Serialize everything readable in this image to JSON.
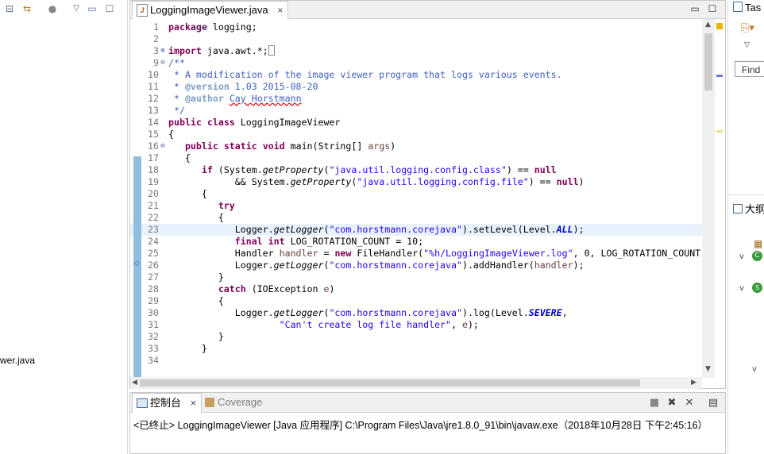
{
  "editor": {
    "tab_label": "LoggingImageViewer.java",
    "close_glyph": "×",
    "lines": [
      {
        "n": "1",
        "fold": "",
        "current": false,
        "tokens": [
          [
            "kw",
            "package"
          ],
          [
            "",
            " logging;"
          ]
        ]
      },
      {
        "n": "2",
        "fold": "",
        "current": false,
        "tokens": []
      },
      {
        "n": "3",
        "fold": "⊕",
        "current": false,
        "tokens": [
          [
            "kw",
            "import"
          ],
          [
            "",
            " java.awt.*;"
          ],
          [
            "box",
            " "
          ]
        ]
      },
      {
        "n": "9",
        "fold": "⊖",
        "current": false,
        "tokens": [
          [
            "cm",
            "/**"
          ]
        ]
      },
      {
        "n": "10",
        "fold": "",
        "current": false,
        "tokens": [
          [
            "cm",
            " * A modification of the image viewer program that logs various events."
          ]
        ]
      },
      {
        "n": "11",
        "fold": "",
        "current": false,
        "tokens": [
          [
            "cm",
            " * "
          ],
          [
            "ann",
            "@version"
          ],
          [
            "cm",
            " 1.03 2015-08-20"
          ]
        ]
      },
      {
        "n": "12",
        "fold": "",
        "current": false,
        "tokens": [
          [
            "cm",
            " * "
          ],
          [
            "ann",
            "@author"
          ],
          [
            "cm",
            " "
          ],
          [
            "cmsq",
            "Cay Horstmann"
          ]
        ]
      },
      {
        "n": "13",
        "fold": "",
        "current": false,
        "tokens": [
          [
            "cm",
            " */"
          ]
        ]
      },
      {
        "n": "14",
        "fold": "",
        "current": false,
        "tokens": [
          [
            "kw",
            "public"
          ],
          [
            "",
            " "
          ],
          [
            "kw",
            "class"
          ],
          [
            "",
            " LoggingImageViewer"
          ]
        ]
      },
      {
        "n": "15",
        "fold": "",
        "current": false,
        "tokens": [
          [
            "",
            "{"
          ]
        ]
      },
      {
        "n": "16",
        "fold": "⊖",
        "current": false,
        "tokens": [
          [
            "",
            "   "
          ],
          [
            "kw",
            "public"
          ],
          [
            "",
            " "
          ],
          [
            "kw",
            "static"
          ],
          [
            "",
            " "
          ],
          [
            "kw",
            "void"
          ],
          [
            "",
            " main(String[] "
          ],
          [
            "var",
            "args"
          ],
          [
            "",
            ")"
          ]
        ]
      },
      {
        "n": "17",
        "fold": "",
        "current": false,
        "tokens": [
          [
            "",
            "   {"
          ]
        ]
      },
      {
        "n": "18",
        "fold": "",
        "current": false,
        "tokens": [
          [
            "",
            "      "
          ],
          [
            "kw",
            "if"
          ],
          [
            "",
            " (System."
          ],
          [
            "it",
            "getProperty"
          ],
          [
            "",
            "("
          ],
          [
            "str",
            "\"java.util.logging.config.class\""
          ],
          [
            "",
            ") == "
          ],
          [
            "kw",
            "null"
          ]
        ]
      },
      {
        "n": "19",
        "fold": "",
        "current": false,
        "tokens": [
          [
            "",
            "            && System."
          ],
          [
            "it",
            "getProperty"
          ],
          [
            "",
            "("
          ],
          [
            "str",
            "\"java.util.logging.config.file\""
          ],
          [
            "",
            ") == "
          ],
          [
            "kw",
            "null"
          ],
          [
            "",
            ")"
          ]
        ]
      },
      {
        "n": "20",
        "fold": "",
        "current": false,
        "tokens": [
          [
            "",
            "      {"
          ]
        ]
      },
      {
        "n": "21",
        "fold": "",
        "current": false,
        "tokens": [
          [
            "",
            "         "
          ],
          [
            "kw",
            "try"
          ]
        ]
      },
      {
        "n": "22",
        "fold": "",
        "current": false,
        "tokens": [
          [
            "",
            "         {"
          ]
        ]
      },
      {
        "n": "23",
        "fold": "",
        "current": true,
        "tokens": [
          [
            "",
            "            Logger."
          ],
          [
            "it",
            "getLogger"
          ],
          [
            "",
            "("
          ],
          [
            "str",
            "\"com.horstmann.corejava\""
          ],
          [
            "",
            ").setLevel(Level."
          ],
          [
            "cst",
            "ALL"
          ],
          [
            "",
            ");"
          ]
        ]
      },
      {
        "n": "24",
        "fold": "",
        "current": false,
        "tokens": [
          [
            "",
            "            "
          ],
          [
            "kw",
            "final"
          ],
          [
            "",
            " "
          ],
          [
            "kw",
            "int"
          ],
          [
            "",
            " LOG_ROTATION_COUNT = 10;"
          ]
        ]
      },
      {
        "n": "25",
        "fold": "",
        "current": false,
        "tokens": [
          [
            "",
            "            Handler "
          ],
          [
            "var",
            "handler"
          ],
          [
            "",
            " = "
          ],
          [
            "kw",
            "new"
          ],
          [
            "",
            " FileHandler("
          ],
          [
            "str",
            "\"%h/LoggingImageViewer.log\""
          ],
          [
            "",
            ", 0, LOG_ROTATION_COUNT"
          ]
        ]
      },
      {
        "n": "26",
        "fold": "",
        "current": false,
        "tokens": [
          [
            "",
            "            Logger."
          ],
          [
            "it",
            "getLogger"
          ],
          [
            "",
            "("
          ],
          [
            "str",
            "\"com.horstmann.corejava\""
          ],
          [
            "",
            ").addHandler("
          ],
          [
            "var",
            "handler"
          ],
          [
            "",
            ");"
          ]
        ]
      },
      {
        "n": "27",
        "fold": "",
        "current": false,
        "tokens": [
          [
            "",
            "         }"
          ]
        ]
      },
      {
        "n": "28",
        "fold": "",
        "current": false,
        "tokens": [
          [
            "",
            "         "
          ],
          [
            "kw",
            "catch"
          ],
          [
            "",
            " (IOException "
          ],
          [
            "var",
            "e"
          ],
          [
            "",
            ")"
          ]
        ]
      },
      {
        "n": "29",
        "fold": "",
        "current": false,
        "tokens": [
          [
            "",
            "         {"
          ]
        ]
      },
      {
        "n": "30",
        "fold": "",
        "current": false,
        "tokens": [
          [
            "",
            "            Logger."
          ],
          [
            "it",
            "getLogger"
          ],
          [
            "",
            "("
          ],
          [
            "str",
            "\"com.horstmann.corejava\""
          ],
          [
            "",
            ").log(Level."
          ],
          [
            "cst",
            "SEVERE"
          ],
          [
            "",
            ","
          ]
        ]
      },
      {
        "n": "31",
        "fold": "",
        "current": false,
        "tokens": [
          [
            "",
            "                    "
          ],
          [
            "str",
            "\"Can't create log file handler\""
          ],
          [
            "",
            ", "
          ],
          [
            "var",
            "e"
          ],
          [
            "",
            ");"
          ]
        ]
      },
      {
        "n": "32",
        "fold": "",
        "current": false,
        "tokens": [
          [
            "",
            "         }"
          ]
        ]
      },
      {
        "n": "33",
        "fold": "",
        "current": false,
        "tokens": [
          [
            "",
            "      }"
          ]
        ]
      },
      {
        "n": "34",
        "fold": "",
        "current": false,
        "tokens": []
      }
    ]
  },
  "left_panel": {
    "file_label": "wer.java"
  },
  "right_panel": {
    "tab_label": "Tas",
    "find_placeholder": "Find",
    "outline_label": "大纲"
  },
  "console": {
    "tab_label": "控制台",
    "close_glyph": "×",
    "coverage_label": "Coverage",
    "status_text": "<已终止> LoggingImageViewer [Java 应用程序] C:\\Program Files\\Java\\jre1.8.0_91\\bin\\javaw.exe（2018年10月28日 下午2:45:16）"
  },
  "colors": {
    "keyword": "#7f0055",
    "string": "#2a00ff",
    "comment": "#3f5fbf",
    "current_line": "#e8f2fe",
    "change_bar": "#8fbedf"
  }
}
